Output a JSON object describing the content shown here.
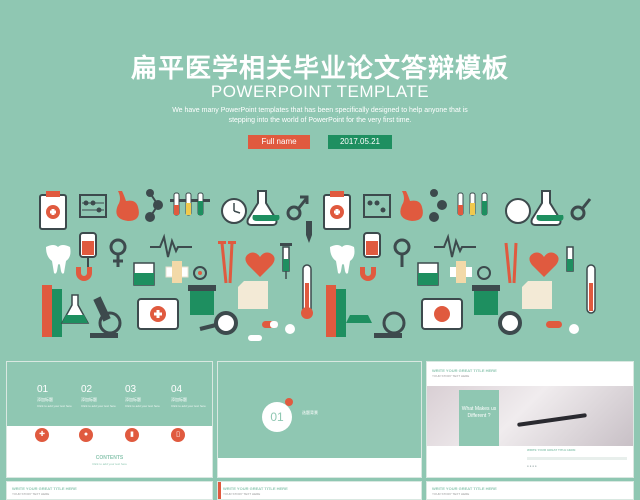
{
  "hero": {
    "title_cn": "扁平医学相关毕业论文答辩模板",
    "title_en": "POWERPOINT TEMPLATE",
    "description": "We have many PowerPoint templates that has been specifically designed to help anyone that is stepping into the world of PowerPoint for the very first time.",
    "name_label": "Full name",
    "date": "2017.05.21"
  },
  "icons": [
    "clipboard-icon",
    "abacus-icon",
    "stomach-icon",
    "molecule-icon",
    "test-tubes-icon",
    "clock-icon",
    "flask-icon",
    "male-symbol-icon",
    "dropper-icon",
    "tooth-icon",
    "blood-bag-icon",
    "female-symbol-icon",
    "heartbeat-icon",
    "crutches-icon",
    "heart-icon",
    "syringe-icon",
    "magnet-icon",
    "beaker-icon",
    "bandage-icon",
    "virus-icon",
    "paper-icon",
    "thermometer-icon",
    "books-icon",
    "microscope-icon",
    "erlenmeyer-flask-icon",
    "first-aid-kit-icon",
    "pill-box-icon",
    "magnifier-icon",
    "capsule-icon"
  ],
  "thumb1": {
    "items": [
      {
        "num": "01",
        "label": "添加标题",
        "sub": "Click to add your text here"
      },
      {
        "num": "02",
        "label": "添加标题",
        "sub": "Click to add your text here"
      },
      {
        "num": "03",
        "label": "添加标题",
        "sub": "Click to add your text here"
      },
      {
        "num": "04",
        "label": "添加标题",
        "sub": "Click to add your text here"
      }
    ],
    "contents": "CONTENTS",
    "contents_sub": "Click to add your text here"
  },
  "thumb2": {
    "num": "01",
    "title": "选题背景"
  },
  "thumb3": {
    "header": "WRITE YOUR GREAT TITLE HERE",
    "header_sub": "YOUR STORY TEXT HERE",
    "box_text": "What Makes us Different ?",
    "footer": "WRITE YOUR GREAT TITLE HERE"
  },
  "thumb4": {
    "header": "WRITE YOUR GREAT TITLE HERE",
    "sub": "YOUR STORY TEXT HERE"
  },
  "thumb5": {
    "header": "WRITE YOUR GREAT TITLE HERE",
    "sub": "YOUR STORY TEXT HERE"
  },
  "thumb6": {
    "header": "WRITE YOUR GREAT TITLE HERE",
    "sub": "YOUR STORY TEXT HERE"
  },
  "colors": {
    "mint": "#8fc7b2",
    "red": "#e05a3f",
    "green": "#1e8f60",
    "dark": "#3d4a4d"
  }
}
